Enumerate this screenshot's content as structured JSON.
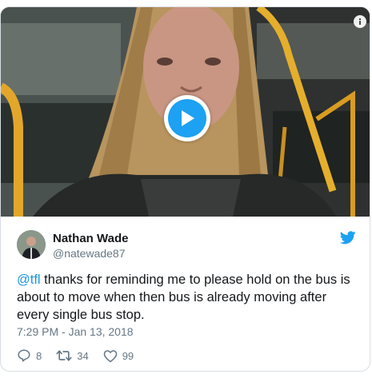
{
  "video": {
    "play_icon": "play-icon",
    "info_icon": "info-icon"
  },
  "tweet": {
    "author_name": "Nathan Wade",
    "author_handle": "@natewade87",
    "mention": "@tfl",
    "text_rest": " thanks for reminding me to please hold on the bus is about to move when then bus is already moving after every single bus stop.",
    "timestamp": "7:29 PM - Jan 13, 2018"
  },
  "actions": {
    "replies": "8",
    "retweets": "34",
    "likes": "99"
  },
  "colors": {
    "brand": "#1da1f2",
    "link": "#1b95e0",
    "text": "#14171a",
    "muted": "#657786"
  }
}
